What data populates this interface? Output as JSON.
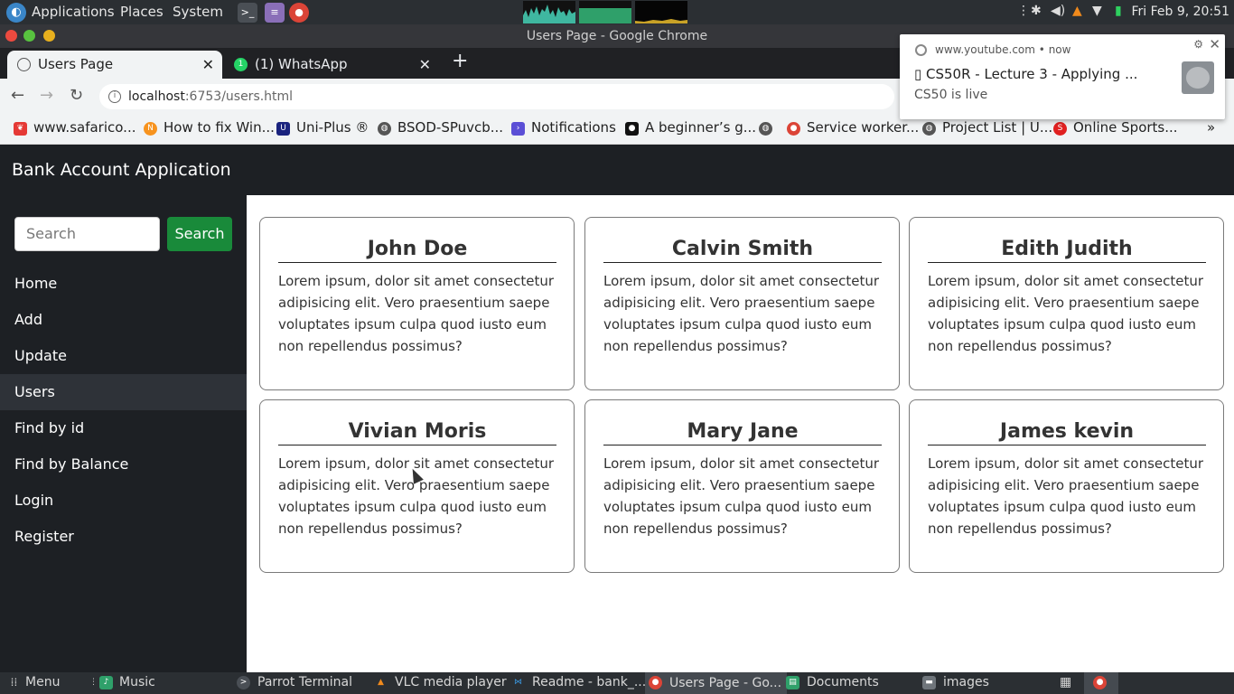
{
  "system_bar": {
    "menus": [
      "Applications",
      "Places",
      "System"
    ],
    "clock": "Fri Feb 9, 20:51"
  },
  "window": {
    "title": "Users Page - Google Chrome"
  },
  "tabs": [
    {
      "label": "Users Page",
      "active": true
    },
    {
      "label": "(1) WhatsApp",
      "active": false
    }
  ],
  "address": {
    "host": "localhost",
    "path": ":6753/users.html"
  },
  "bookmarks": [
    "www.safarico...",
    "How to fix Win...",
    "Uni-Plus ®",
    "BSOD-SPuvcb...",
    "Notifications",
    "A beginner’s g...",
    "",
    "Service worker...",
    "Project List | U...",
    "Online Sports..."
  ],
  "notification": {
    "source": "www.youtube.com",
    "time": "now",
    "title": "▯ CS50R - Lecture 3 - Applying ...",
    "body": "CS50 is live"
  },
  "app": {
    "title": "Bank Account Application",
    "search_placeholder": "Search",
    "search_button": "Search",
    "nav": [
      "Home",
      "Add",
      "Update",
      "Users",
      "Find by id",
      "Find by Balance",
      "Login",
      "Register"
    ],
    "active_nav": "Users"
  },
  "users": [
    {
      "name": "John Doe",
      "desc": "Lorem ipsum, dolor sit amet consectetur adipisicing elit. Vero praesentium saepe voluptates ipsum culpa quod iusto eum non repellendus possimus?"
    },
    {
      "name": "Calvin Smith",
      "desc": "Lorem ipsum, dolor sit amet consectetur adipisicing elit. Vero praesentium saepe voluptates ipsum culpa quod iusto eum non repellendus possimus?"
    },
    {
      "name": "Edith Judith",
      "desc": "Lorem ipsum, dolor sit amet consectetur adipisicing elit. Vero praesentium saepe voluptates ipsum culpa quod iusto eum non repellendus possimus?"
    },
    {
      "name": "Vivian Moris",
      "desc": "Lorem ipsum, dolor sit amet consectetur adipisicing elit. Vero praesentium saepe voluptates ipsum culpa quod iusto eum non repellendus possimus?"
    },
    {
      "name": "Mary Jane",
      "desc": "Lorem ipsum, dolor sit amet consectetur adipisicing elit. Vero praesentium saepe voluptates ipsum culpa quod iusto eum non repellendus possimus?"
    },
    {
      "name": "James kevin",
      "desc": "Lorem ipsum, dolor sit amet consectetur adipisicing elit. Vero praesentium saepe voluptates ipsum culpa quod iusto eum non repellendus possimus?"
    }
  ],
  "taskbar": [
    "Menu",
    "Music",
    "Parrot Terminal",
    "VLC media player",
    "Readme - bank_...",
    "Users Page - Go...",
    "Documents",
    "images"
  ]
}
